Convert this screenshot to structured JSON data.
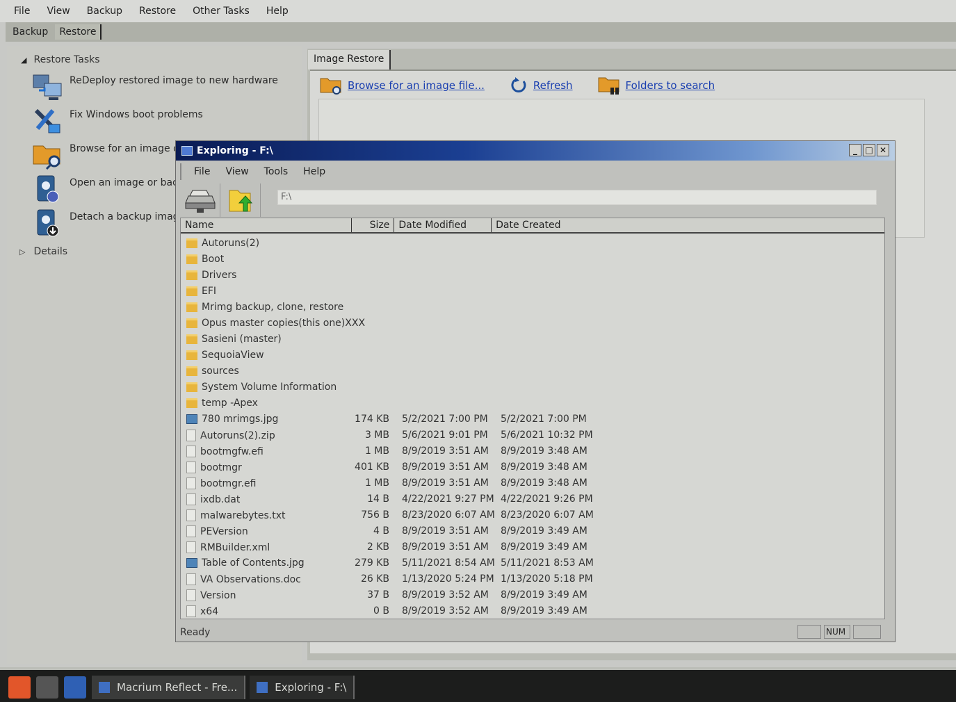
{
  "menubar": [
    "File",
    "View",
    "Backup",
    "Restore",
    "Other Tasks",
    "Help"
  ],
  "tabs": [
    "Backup",
    "Restore"
  ],
  "restore_tasks": {
    "title": "Restore Tasks",
    "items": [
      {
        "label": "ReDeploy restored image to new hardware",
        "icon": "redeploy-icon"
      },
      {
        "label": "Fix Windows boot problems",
        "icon": "tools-icon"
      },
      {
        "label": "Browse for an image or",
        "icon": "folder-search-icon"
      },
      {
        "label": "Open an image or back",
        "icon": "disk-open-icon"
      },
      {
        "label": "Detach a backup image",
        "icon": "disk-detach-icon"
      }
    ],
    "details_label": "Details"
  },
  "image_restore": {
    "tab_label": "Image Restore",
    "browse_link": "Browse for an image file...",
    "refresh_link": "Refresh",
    "folders_link": "Folders to search"
  },
  "explorer": {
    "title": "Exploring - F:\\",
    "menu": [
      "File",
      "View",
      "Tools",
      "Help"
    ],
    "address": "F:\\",
    "columns": [
      "Name",
      "Size",
      "Date Modified",
      "Date Created"
    ],
    "folders": [
      "Autoruns(2)",
      "Boot",
      "Drivers",
      "EFI",
      "Mrimg backup, clone, restore",
      "Opus master copies(this one)XXX",
      "Sasieni (master)",
      "SequoiaView",
      "sources",
      "System Volume Information",
      "temp -Apex"
    ],
    "files": [
      {
        "name": "780 mrimgs.jpg",
        "size": "174 KB",
        "modified": "5/2/2021 7:00 PM",
        "created": "5/2/2021 7:00 PM",
        "type": "image"
      },
      {
        "name": "Autoruns(2).zip",
        "size": "3 MB",
        "modified": "5/6/2021 9:01 PM",
        "created": "5/6/2021 10:32 PM",
        "type": "doc"
      },
      {
        "name": "bootmgfw.efi",
        "size": "1 MB",
        "modified": "8/9/2019 3:51 AM",
        "created": "8/9/2019 3:48 AM",
        "type": "doc"
      },
      {
        "name": "bootmgr",
        "size": "401 KB",
        "modified": "8/9/2019 3:51 AM",
        "created": "8/9/2019 3:48 AM",
        "type": "doc"
      },
      {
        "name": "bootmgr.efi",
        "size": "1 MB",
        "modified": "8/9/2019 3:51 AM",
        "created": "8/9/2019 3:48 AM",
        "type": "doc"
      },
      {
        "name": "ixdb.dat",
        "size": "14 B",
        "modified": "4/22/2021 9:27 PM",
        "created": "4/22/2021 9:26 PM",
        "type": "doc"
      },
      {
        "name": "malwarebytes.txt",
        "size": "756 B",
        "modified": "8/23/2020 6:07 AM",
        "created": "8/23/2020 6:07 AM",
        "type": "doc"
      },
      {
        "name": "PEVersion",
        "size": "4 B",
        "modified": "8/9/2019 3:51 AM",
        "created": "8/9/2019 3:49 AM",
        "type": "doc"
      },
      {
        "name": "RMBuilder.xml",
        "size": "2 KB",
        "modified": "8/9/2019 3:51 AM",
        "created": "8/9/2019 3:49 AM",
        "type": "doc"
      },
      {
        "name": "Table of Contents.jpg",
        "size": "279 KB",
        "modified": "5/11/2021 8:54 AM",
        "created": "5/11/2021 8:53 AM",
        "type": "image"
      },
      {
        "name": "VA Observations.doc",
        "size": "26 KB",
        "modified": "1/13/2020 5:24 PM",
        "created": "1/13/2020 5:18 PM",
        "type": "doc"
      },
      {
        "name": "Version",
        "size": "37 B",
        "modified": "8/9/2019 3:52 AM",
        "created": "8/9/2019 3:49 AM",
        "type": "doc"
      },
      {
        "name": "x64",
        "size": "0 B",
        "modified": "8/9/2019 3:52 AM",
        "created": "8/9/2019 3:49 AM",
        "type": "doc"
      }
    ],
    "status": "Ready",
    "status_panes": [
      "",
      "NUM",
      ""
    ]
  },
  "taskbar": {
    "tasks": [
      "Macrium Reflect - Fre...",
      "Exploring - F:\\"
    ]
  },
  "colors": {
    "title_dark": "#0a1b54",
    "link": "#1a3fb0",
    "folder": "#e8b53c"
  }
}
